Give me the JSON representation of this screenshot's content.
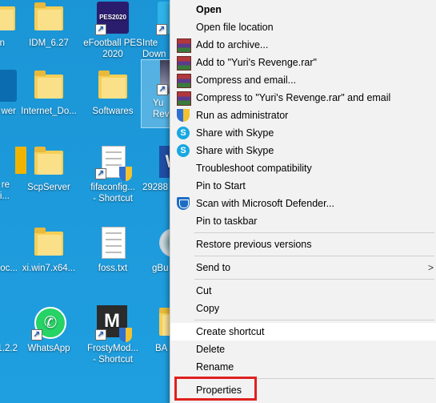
{
  "desktop": {
    "icons": [
      {
        "label": "n",
        "icon": "folder-icon"
      },
      {
        "label": "IDM_6.27",
        "icon": "folder-icon"
      },
      {
        "label": "eFootball PES\n2020",
        "icon": "game-shortcut-icon"
      },
      {
        "label": "Inte\nDown",
        "icon": "app-shortcut-icon"
      },
      {
        "label": "wer",
        "icon": "app-icon"
      },
      {
        "label": "Internet_Do...",
        "icon": "folder-icon"
      },
      {
        "label": "Softwares",
        "icon": "folder-icon"
      },
      {
        "label": "Yu\nReve",
        "icon": "yuris-revenge-icon"
      },
      {
        "label": "re\nti...",
        "icon": "yellow-app-icon"
      },
      {
        "label": "ScpServer",
        "icon": "folder-icon"
      },
      {
        "label": "fifaconfig...\n- Shortcut",
        "icon": "config-shortcut-icon"
      },
      {
        "label": "29288",
        "icon": "word-document-icon"
      },
      {
        "label": "oc...",
        "icon": "folder-icon"
      },
      {
        "label": "xi.win7.x64...",
        "icon": "folder-icon"
      },
      {
        "label": "foss.txt",
        "icon": "text-file-icon"
      },
      {
        "label": "gBu",
        "icon": "disc-icon"
      },
      {
        "label": "1.2.2",
        "icon": "app-icon"
      },
      {
        "label": "WhatsApp",
        "icon": "whatsapp-icon"
      },
      {
        "label": "FrostyMod...\n- Shortcut",
        "icon": "frostymod-icon"
      },
      {
        "label": "BA",
        "icon": "folder-icon"
      }
    ],
    "game_badge": "PES2020",
    "m2_badge": "M"
  },
  "menu": {
    "items": [
      {
        "label": "Open",
        "icon": "",
        "bold": true
      },
      {
        "label": "Open file location",
        "icon": ""
      },
      {
        "label": "Add to archive...",
        "icon": "winrar-icon"
      },
      {
        "label": "Add to \"Yuri's Revenge.rar\"",
        "icon": "winrar-icon"
      },
      {
        "label": "Compress and email...",
        "icon": "winrar-icon"
      },
      {
        "label": "Compress to \"Yuri's Revenge.rar\" and email",
        "icon": "winrar-icon"
      },
      {
        "label": "Run as administrator",
        "icon": "uac-shield-icon"
      },
      {
        "label": "Share with Skype",
        "icon": "skype-icon"
      },
      {
        "label": "Share with Skype",
        "icon": "skype-icon"
      },
      {
        "label": "Troubleshoot compatibility",
        "icon": ""
      },
      {
        "label": "Pin to Start",
        "icon": ""
      },
      {
        "label": "Scan with Microsoft Defender...",
        "icon": "defender-icon"
      },
      {
        "label": "Pin to taskbar",
        "icon": ""
      },
      {
        "label": "Restore previous versions",
        "icon": ""
      },
      {
        "label": "Send to",
        "icon": "",
        "submenu": true
      },
      {
        "label": "Cut",
        "icon": ""
      },
      {
        "label": "Copy",
        "icon": ""
      },
      {
        "label": "Create shortcut",
        "icon": "",
        "hovered": true
      },
      {
        "label": "Delete",
        "icon": ""
      },
      {
        "label": "Rename",
        "icon": ""
      },
      {
        "label": "Properties",
        "icon": "",
        "highlighted": true
      }
    ],
    "submenu_arrow": ">",
    "skype_glyph": "S"
  },
  "colors": {
    "desktop": "#1e97d8",
    "menu_bg": "#f2f2f2",
    "highlight_border": "#e02020"
  }
}
